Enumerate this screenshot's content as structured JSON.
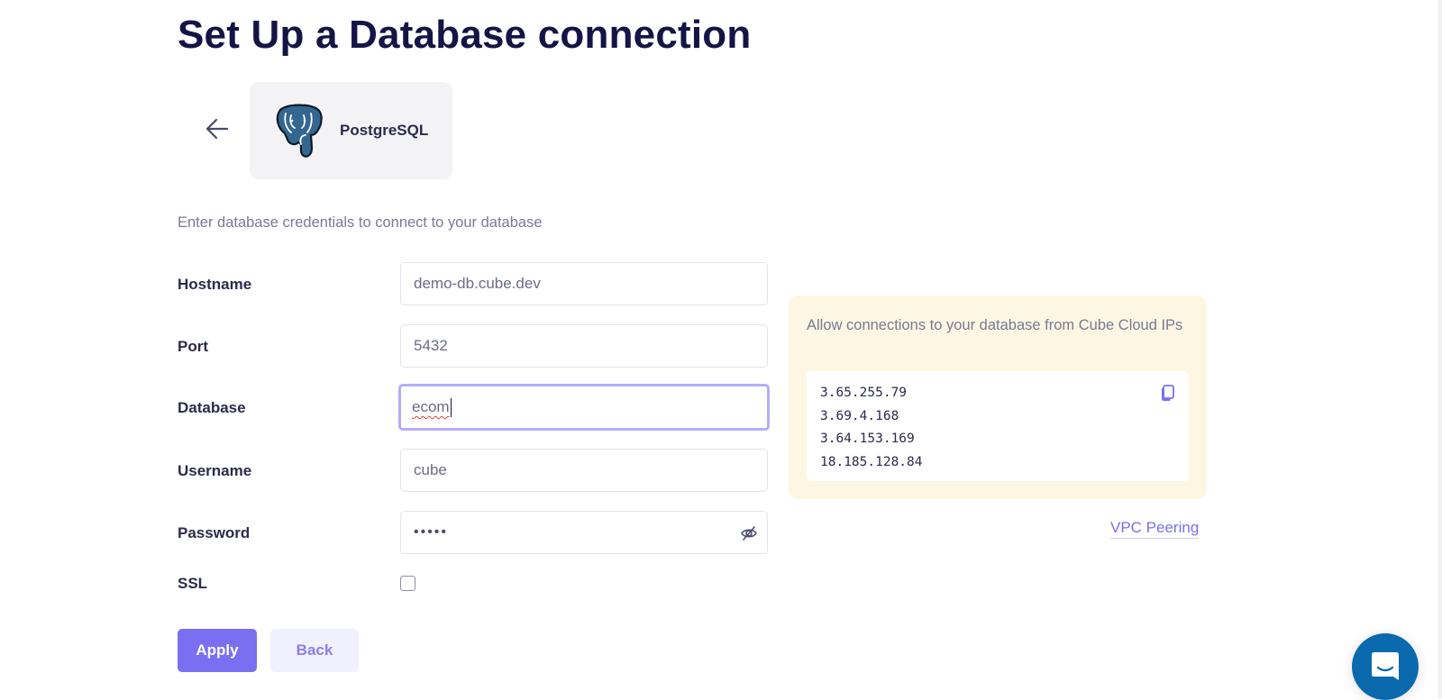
{
  "page": {
    "title": "Set Up a Database connection",
    "subtitle": "Enter database credentials to connect to your database"
  },
  "database": {
    "name": "PostgreSQL",
    "logo_icon": "postgresql-elephant-icon",
    "back_icon": "arrow-left-icon"
  },
  "form": {
    "fields": [
      {
        "label": "Hostname",
        "value": "demo-db.cube.dev"
      },
      {
        "label": "Port",
        "value": "5432"
      },
      {
        "label": "Database",
        "value": "ecom",
        "focused": true
      },
      {
        "label": "Username",
        "value": "cube"
      },
      {
        "label": "Password",
        "value": "•••••",
        "masked": true
      }
    ],
    "ssl": {
      "label": "SSL",
      "checked": false
    }
  },
  "actions": {
    "apply_label": "Apply",
    "back_label": "Back"
  },
  "ip_panel": {
    "text": "Allow connections to your database from Cube Cloud IPs",
    "ips": [
      "3.65.255.79",
      "3.69.4.168",
      "3.64.153.169",
      "18.185.128.84"
    ],
    "copy_icon": "copy-icon"
  },
  "vpc_link": "VPC Peering",
  "colors": {
    "primary": "#7a6ff0",
    "title": "#141446",
    "panel_bg": "#fdf6e3",
    "focus_border": "#b3aef8",
    "chat_bg": "#0a6aad"
  }
}
